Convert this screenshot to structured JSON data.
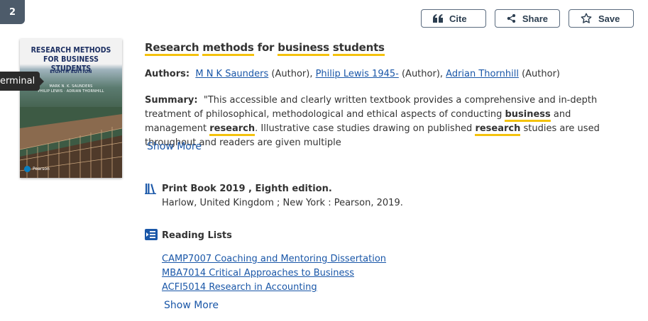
{
  "result": {
    "number": "2"
  },
  "tooltip": {
    "text": "erminal"
  },
  "actions": {
    "cite": {
      "label": "Cite",
      "icon": "quote-icon"
    },
    "share": {
      "label": "Share",
      "icon": "share-icon"
    },
    "save": {
      "label": "Save",
      "icon": "star-icon"
    }
  },
  "cover": {
    "title_line1": "RESEARCH METHODS",
    "title_line2": "FOR BUSINESS STUDENTS",
    "edition": "EIGHTH EDITION",
    "authors_line1": "MARK N. K. SAUNDERS",
    "authors_line2": "PHILIP LEWIS · ADRIAN THORNHILL",
    "publisher": "Pearson"
  },
  "record": {
    "title_parts": [
      "Research",
      " ",
      "methods",
      " for ",
      "business",
      " ",
      "students"
    ],
    "authors_label": "Authors:",
    "authors": [
      {
        "name": "M N K Saunders",
        "role": " (Author), "
      },
      {
        "name": "Philip Lewis 1945-",
        "role": " (Author), "
      },
      {
        "name": "Adrian Thornhill",
        "role": " (Author)"
      }
    ],
    "summary_label": "Summary:",
    "summary_parts": [
      "\"This accessible and clearly written textbook provides a comprehensive and in-depth treatment of philosophical, methodological and ethical aspects of conducting ",
      "business",
      " and management ",
      "research",
      ". Illustrative case studies drawing on published ",
      "research",
      " studies are used throughout and readers are given multiple"
    ],
    "summary_show_more": "Show More"
  },
  "format": {
    "type": "Print Book 2019 , Eighth edition.",
    "publication": "Harlow, United Kingdom ; New York : Pearson, 2019.",
    "icon": "books-icon"
  },
  "reading_lists": {
    "label": "Reading Lists",
    "icon": "reading-list-icon",
    "items": [
      "CAMP7007 Coaching and Mentoring Dissertation",
      "MBA7014 Critical Approaches to Business",
      "ACFI5014 Research in Accounting"
    ],
    "show_more": "Show More"
  },
  "colors": {
    "link": "#1a57a8",
    "highlight": "#f4c20d",
    "badge": "#4d5b6a"
  }
}
